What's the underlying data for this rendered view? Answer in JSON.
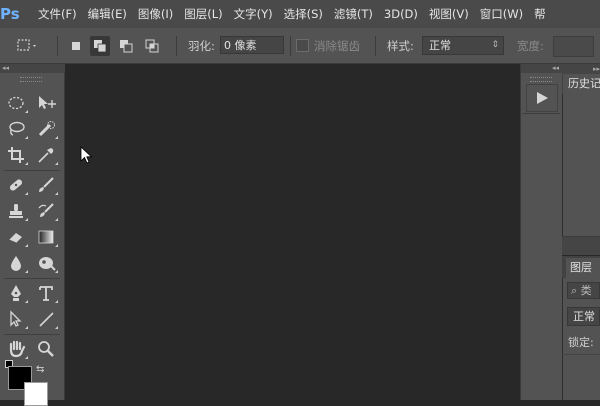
{
  "app": {
    "logo": "Ps",
    "menu": [
      "文件(F)",
      "编辑(E)",
      "图像(I)",
      "图层(L)",
      "文字(Y)",
      "选择(S)",
      "滤镜(T)",
      "3D(D)",
      "视图(V)",
      "窗口(W)",
      "帮"
    ]
  },
  "options_bar": {
    "feather_label": "羽化:",
    "feather_value": "0 像素",
    "anti_alias_label": "消除锯齿",
    "style_label": "样式:",
    "style_value": "正常",
    "width_label": "宽度:"
  },
  "toolbar": {
    "tools": [
      "marquee-tool",
      "move-tool",
      "lasso-tool",
      "quick-selection-tool",
      "crop-tool",
      "eyedropper-tool",
      "spot-healing-tool",
      "brush-tool",
      "clone-stamp-tool",
      "history-brush-tool",
      "eraser-tool",
      "gradient-tool",
      "blur-tool",
      "dodge-tool",
      "pen-tool",
      "type-tool",
      "path-selection-tool",
      "line-tool",
      "hand-tool",
      "zoom-tool"
    ],
    "foreground_color": "#000000",
    "background_color": "#ffffff"
  },
  "panels": {
    "history_tab": "历史记",
    "layers_tab": "图层",
    "layers_filter": "类",
    "blend_mode": "正常",
    "lock_label": "锁定:"
  },
  "colors": {
    "menubar": "#4a4a4a",
    "panel": "#535353",
    "canvas": "#282828",
    "logo": "#6fb2ff"
  }
}
